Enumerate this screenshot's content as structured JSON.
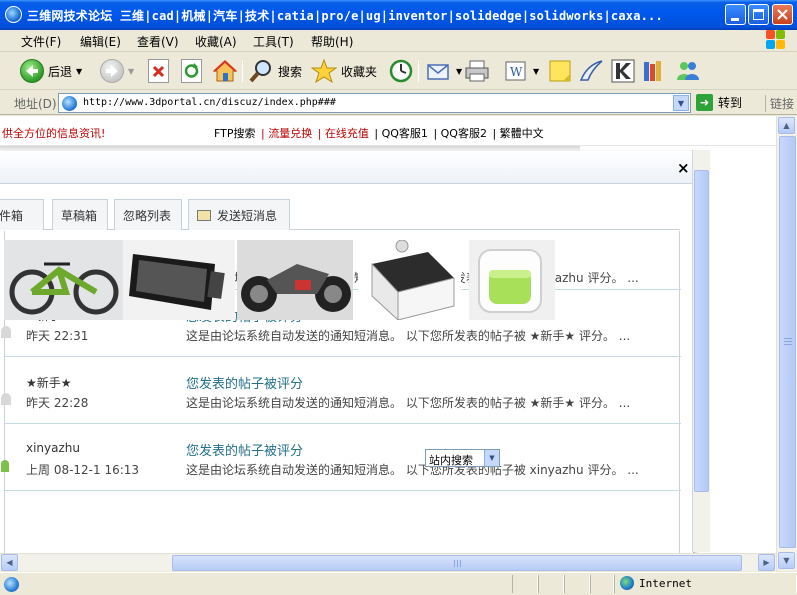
{
  "window": {
    "title": "三维网技术论坛 三维|cad|机械|汽车|技术|catia|pro/e|ug|inventor|solidedge|solidworks|caxa..."
  },
  "menu": {
    "items": [
      "文件(F)",
      "编辑(E)",
      "查看(V)",
      "收藏(A)",
      "工具(T)",
      "帮助(H)"
    ]
  },
  "toolbar": {
    "back_label": "后退",
    "search_label": "搜索",
    "favorites_label": "收藏夹"
  },
  "address": {
    "label": "地址(D)",
    "url": "http://www.3dportal.cn/discuz/index.php###",
    "go_label": "转到",
    "links_label": "链接"
  },
  "site_nav": {
    "slogan": "供全方位的信息资讯!",
    "links": [
      {
        "text": "FTP搜索",
        "color": "#000000"
      },
      {
        "text": "| 流量兑换",
        "color": "#c00000"
      },
      {
        "text": "| 在线充值",
        "color": "#c00000"
      },
      {
        "text": "| QQ客服1",
        "color": "#000000"
      },
      {
        "text": "| QQ客服2",
        "color": "#000000"
      },
      {
        "text": "| 繁體中文",
        "color": "#000000"
      }
    ]
  },
  "dialog": {
    "close_glyph": "×",
    "tabs": [
      "发件箱",
      "草稿箱",
      "忽略列表",
      "发送短消息"
    ],
    "messages": [
      {
        "user": "",
        "time": "",
        "subject": "",
        "preview": "这是由论坛系统自动发送的通知短消息。 以下您所发表的帖子被 xinyazhu 评分。 ..."
      },
      {
        "user": "★新手★",
        "time": "昨天  22:31",
        "subject": "您发表的帖子被评分",
        "preview": "这是由论坛系统自动发送的通知短消息。 以下您所发表的帖子被 ★新手★ 评分。 ..."
      },
      {
        "user": "★新手★",
        "time": "昨天  22:28",
        "subject": "您发表的帖子被评分",
        "preview": "这是由论坛系统自动发送的通知短消息。 以下您所发表的帖子被 ★新手★ 评分。 ..."
      },
      {
        "user": "xinyazhu",
        "time": "上周  08-12-1 16:13",
        "subject": "您发表的帖子被评分",
        "preview": "这是由论坛系统自动发送的通知短消息。 以下您所发表的帖子被 xinyazhu 评分。 ..."
      }
    ],
    "site_search_value": "站内搜索"
  },
  "thumbnails": [
    "bicycle-thumbnail",
    "tablet-device-thumbnail",
    "motorcycle-thumbnail",
    "appliance-thumbnail",
    "green-cup-thumbnail"
  ],
  "statusbar": {
    "zone": "Internet"
  },
  "colors": {
    "titlebar": "#0058ee",
    "link_red": "#c00000",
    "subject_teal": "#23708a"
  }
}
